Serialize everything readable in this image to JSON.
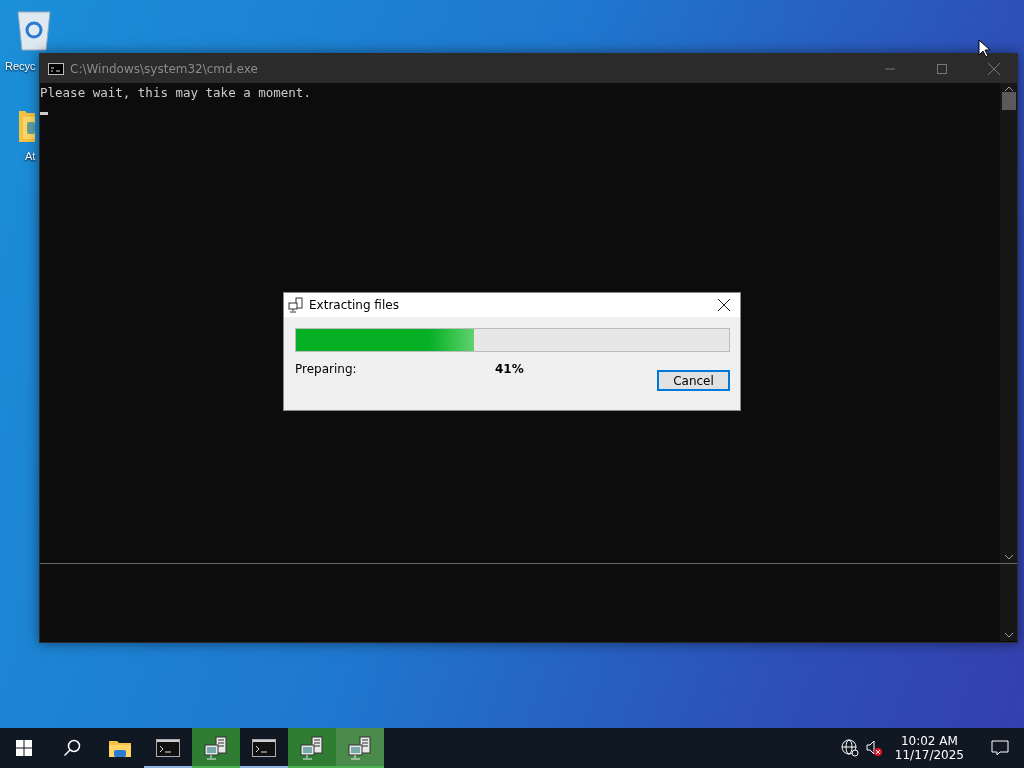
{
  "desktop_icons": [
    {
      "kind": "recycle",
      "label": "Recyc"
    },
    {
      "kind": "folder",
      "label": "At"
    }
  ],
  "console": {
    "title": "C:\\Windows\\system32\\cmd.exe",
    "lines": [
      "Please wait, this may take a moment."
    ]
  },
  "dialog": {
    "title": "Extracting files",
    "progress": {
      "level": 0.41
    },
    "status": "Preparing:",
    "percent": "41%",
    "button": "Cancel"
  },
  "taskbar": {
    "items": [
      {
        "kind": "folder",
        "running": false,
        "flashing": false,
        "selected": false
      },
      {
        "kind": "terminal",
        "running": true,
        "flashing": false,
        "selected": false
      },
      {
        "kind": "server",
        "running": true,
        "flashing": true,
        "selected": false
      },
      {
        "kind": "terminal",
        "running": true,
        "flashing": false,
        "selected": false
      },
      {
        "kind": "server",
        "running": true,
        "flashing": true,
        "selected": false
      },
      {
        "kind": "server",
        "running": true,
        "flashing": true,
        "selected": true
      }
    ],
    "volume_muted": true,
    "time": "10:02 AM",
    "date": "11/17/2025"
  }
}
